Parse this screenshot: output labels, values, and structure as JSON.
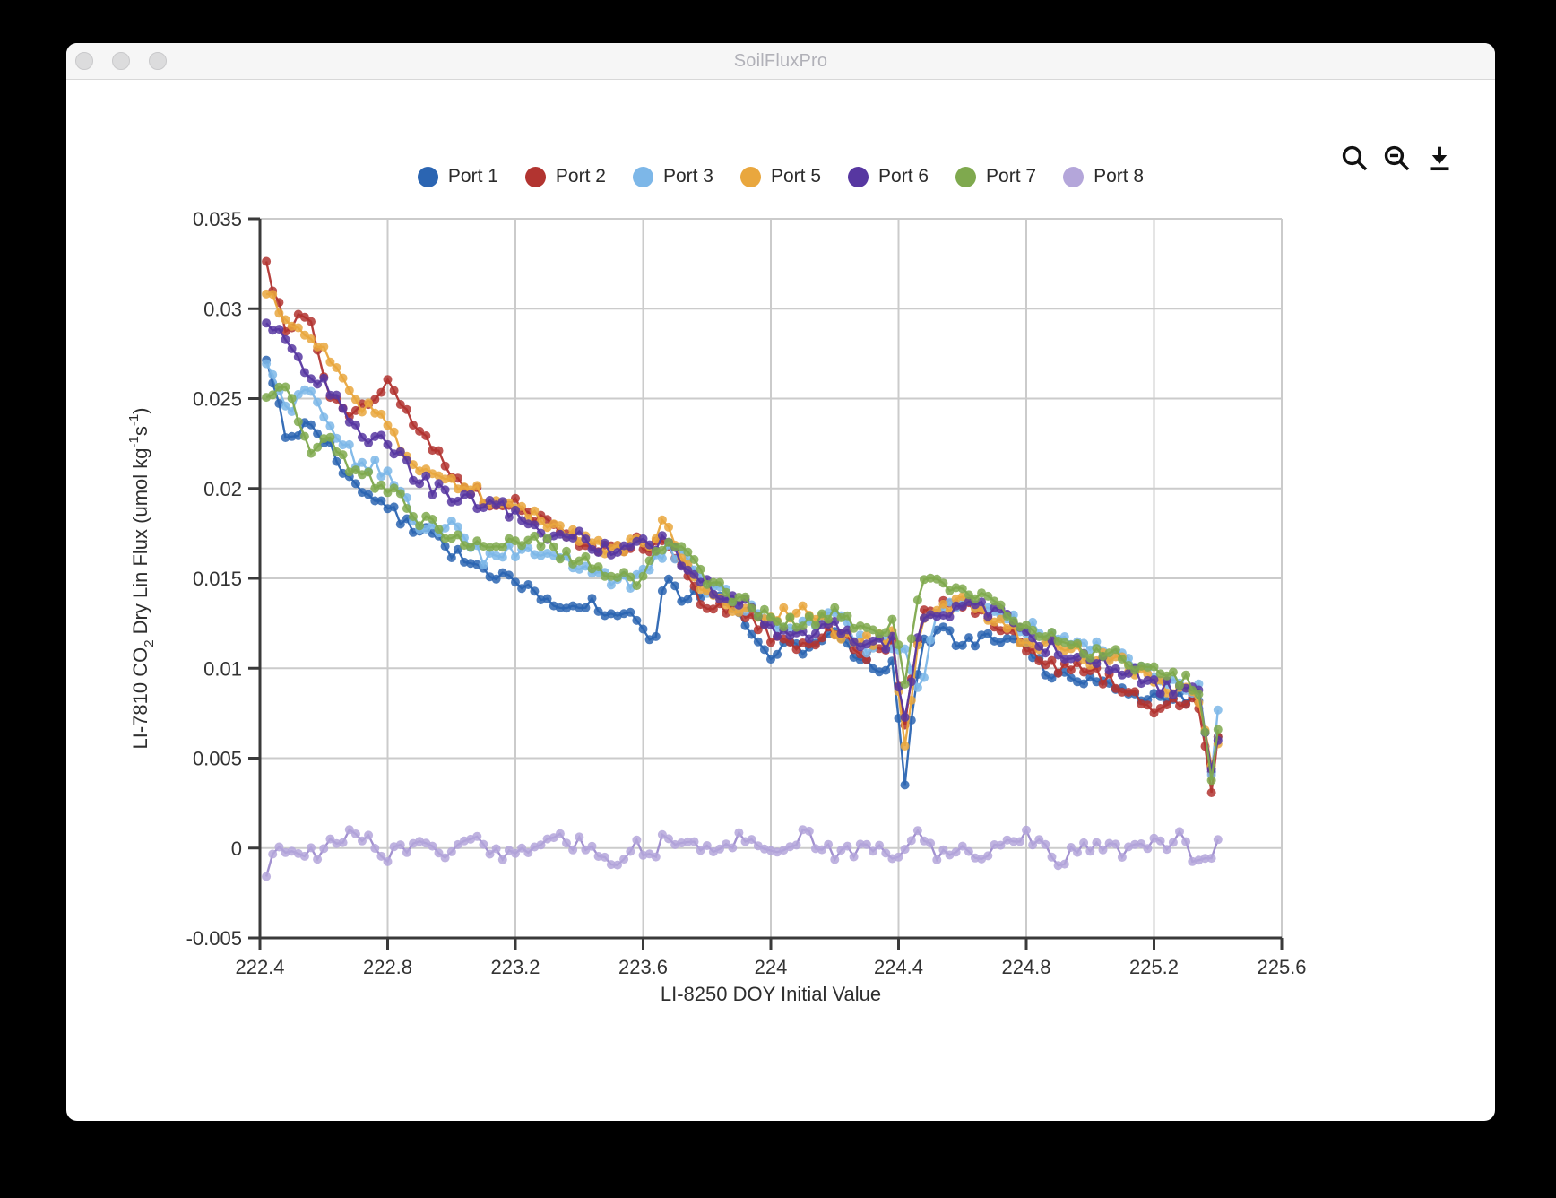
{
  "window": {
    "title": "SoilFluxPro"
  },
  "title_bar": {
    "buttons": [
      "close",
      "minimize",
      "zoom"
    ]
  },
  "toolbar": {
    "icons": [
      {
        "name": "zoom-in-icon"
      },
      {
        "name": "zoom-out-icon"
      },
      {
        "name": "download-icon"
      }
    ]
  },
  "chart_data": {
    "type": "line",
    "title": "",
    "xlabel": "LI-8250 DOY Initial Value",
    "ylabel": "LI-7810 CO2 Dry Lin Flux (umol kg-1s-1)",
    "ylabel_parts": [
      {
        "t": "LI-7810 CO"
      },
      {
        "t": "2",
        "v": "sub"
      },
      {
        "t": " Dry Lin Flux (umol kg",
        "v": ""
      },
      {
        "t": "-1",
        "v": "sup"
      },
      {
        "t": "s",
        "v": ""
      },
      {
        "t": "-1",
        "v": "sup"
      },
      {
        "t": ")",
        "v": ""
      }
    ],
    "xlim": [
      222.4,
      225.6
    ],
    "ylim": [
      -0.005,
      0.035
    ],
    "x_tick_values": [
      222.4,
      222.8,
      223.2,
      223.6,
      224,
      224.4,
      224.8,
      225.2,
      225.6
    ],
    "x_tick_labels": [
      "222.4",
      "222.8",
      "223.2",
      "223.6",
      "224",
      "224.4",
      "224.8",
      "225.2",
      "225.6"
    ],
    "y_tick_values": [
      -0.005,
      0,
      0.005,
      0.01,
      0.015,
      0.02,
      0.025,
      0.03,
      0.035
    ],
    "y_tick_labels": [
      "-0.005",
      "0",
      "0.005",
      "0.01",
      "0.015",
      "0.02",
      "0.025",
      "0.03",
      "0.035"
    ],
    "grid": true,
    "legend_position": "top",
    "x_step": 0.02,
    "anchor_x": [
      222.42,
      222.48,
      222.55,
      222.62,
      222.7,
      222.8,
      222.9,
      223.0,
      223.1,
      223.2,
      223.3,
      223.4,
      223.5,
      223.58,
      223.63,
      223.67,
      223.72,
      223.8,
      223.9,
      224.0,
      224.1,
      224.2,
      224.3,
      224.38,
      224.42,
      224.47,
      224.52,
      224.6,
      224.7,
      224.8,
      224.9,
      225.0,
      225.1,
      225.2,
      225.28,
      225.34,
      225.38,
      225.4
    ],
    "series": [
      {
        "name": "Port 1",
        "color": "#2b65b2",
        "seed": 1,
        "noise": 0.00045,
        "anchor_y": [
          0.027,
          0.0232,
          0.0235,
          0.0222,
          0.02,
          0.019,
          0.0176,
          0.0165,
          0.0152,
          0.015,
          0.0135,
          0.0138,
          0.0131,
          0.013,
          0.011,
          0.015,
          0.0138,
          0.014,
          0.0131,
          0.0109,
          0.0112,
          0.0118,
          0.0103,
          0.01,
          0.0036,
          0.0115,
          0.012,
          0.0115,
          0.0116,
          0.011,
          0.0093,
          0.0095,
          0.0089,
          0.0082,
          0.0086,
          0.0081,
          0.004,
          0.0058
        ]
      },
      {
        "name": "Port 2",
        "color": "#b23430",
        "seed": 2,
        "noise": 0.00045,
        "anchor_y": [
          0.0323,
          0.029,
          0.0296,
          0.0254,
          0.024,
          0.0258,
          0.0235,
          0.021,
          0.0195,
          0.019,
          0.018,
          0.0172,
          0.0166,
          0.0172,
          0.0168,
          0.0173,
          0.0155,
          0.0133,
          0.0131,
          0.0118,
          0.0114,
          0.012,
          0.0108,
          0.0116,
          0.0072,
          0.0128,
          0.0135,
          0.0138,
          0.0124,
          0.0112,
          0.01,
          0.0098,
          0.0089,
          0.0079,
          0.0082,
          0.0078,
          0.0033,
          0.0065
        ]
      },
      {
        "name": "Port 3",
        "color": "#7db7e8",
        "seed": 3,
        "noise": 0.00045,
        "anchor_y": [
          0.027,
          0.0242,
          0.026,
          0.0235,
          0.0215,
          0.021,
          0.018,
          0.0178,
          0.0162,
          0.0165,
          0.0163,
          0.0156,
          0.015,
          0.0148,
          0.016,
          0.0165,
          0.0163,
          0.0145,
          0.0137,
          0.0125,
          0.0122,
          0.013,
          0.0112,
          0.0114,
          0.011,
          0.008,
          0.0133,
          0.0136,
          0.0131,
          0.0122,
          0.0119,
          0.0112,
          0.0106,
          0.0096,
          0.0092,
          0.0089,
          0.0045,
          0.0078
        ]
      },
      {
        "name": "Port 5",
        "color": "#e9a73e",
        "seed": 4,
        "noise": 0.00045,
        "anchor_y": [
          0.0307,
          0.0297,
          0.0282,
          0.0272,
          0.025,
          0.0235,
          0.021,
          0.0205,
          0.0196,
          0.0193,
          0.018,
          0.0171,
          0.0166,
          0.017,
          0.0168,
          0.0185,
          0.016,
          0.0144,
          0.0134,
          0.0125,
          0.0136,
          0.0122,
          0.0115,
          0.0118,
          0.0058,
          0.0128,
          0.0132,
          0.014,
          0.0128,
          0.0116,
          0.0112,
          0.0106,
          0.0105,
          0.0092,
          0.0086,
          0.0083,
          0.0048,
          0.0055
        ]
      },
      {
        "name": "Port 6",
        "color": "#5737a1",
        "seed": 5,
        "noise": 0.00045,
        "anchor_y": [
          0.029,
          0.0282,
          0.0262,
          0.0256,
          0.0232,
          0.0224,
          0.0205,
          0.0195,
          0.0191,
          0.0187,
          0.0176,
          0.0173,
          0.0166,
          0.0171,
          0.0165,
          0.0176,
          0.0158,
          0.0146,
          0.0137,
          0.0123,
          0.0117,
          0.0125,
          0.0111,
          0.0115,
          0.007,
          0.0126,
          0.0131,
          0.0134,
          0.0132,
          0.0117,
          0.011,
          0.0104,
          0.01,
          0.0091,
          0.0088,
          0.0085,
          0.004,
          0.0062
        ]
      },
      {
        "name": "Port 7",
        "color": "#7fa94e",
        "seed": 6,
        "noise": 0.00045,
        "anchor_y": [
          0.0247,
          0.0258,
          0.0222,
          0.023,
          0.0208,
          0.0202,
          0.0183,
          0.0172,
          0.0167,
          0.0174,
          0.0168,
          0.016,
          0.0152,
          0.0148,
          0.0158,
          0.017,
          0.0165,
          0.0147,
          0.0138,
          0.0128,
          0.0125,
          0.0131,
          0.0119,
          0.0124,
          0.0095,
          0.0152,
          0.0147,
          0.014,
          0.0138,
          0.0122,
          0.0115,
          0.011,
          0.0105,
          0.0099,
          0.0093,
          0.009,
          0.0042,
          0.0068
        ]
      },
      {
        "name": "Port 8",
        "color": "#b4a6da",
        "line_color": "#9d8bce",
        "seed": 7,
        "noise": 0.0005,
        "anchor_y": [
          -0.0011,
          0.0002,
          -0.0006,
          0.0004,
          0.0011,
          -0.0004,
          0.0002,
          -0.0002,
          0.0003,
          -0.0005,
          0.0008,
          0.0002,
          -0.0007,
          0.0001,
          -0.0003,
          0.0009,
          0.0,
          -0.0002,
          0.0004,
          -0.0006,
          0.0008,
          -0.0003,
          0.0001,
          -0.0004,
          0.0002,
          0.0006,
          -0.0005,
          0.0001,
          -0.0003,
          0.0005,
          -0.0006,
          0.0002,
          -0.0004,
          0.0001,
          0.0007,
          -0.0008,
          -0.0003,
          0.0001
        ]
      }
    ],
    "colors": {
      "grid": "#cbcbcb",
      "axis": "#3a3a3a",
      "tick_label": "#333333",
      "axis_title": "#2e2e2e"
    }
  }
}
